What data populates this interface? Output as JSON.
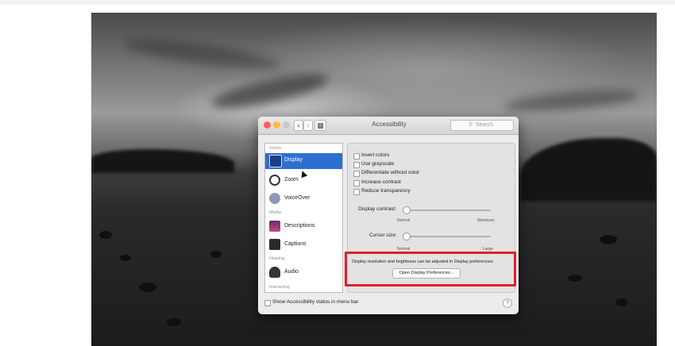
{
  "window": {
    "title": "Accessibility"
  },
  "search": {
    "placeholder": "Search",
    "icon": "search-icon"
  },
  "toolbar": {
    "back": "‹",
    "forward": "›",
    "grid": "▦"
  },
  "sidebar": {
    "sections": [
      {
        "header": "Vision",
        "items": [
          {
            "label": "Display",
            "selected": true,
            "icon": "display-icon"
          },
          {
            "label": "Zoom",
            "icon": "zoom-icon"
          },
          {
            "label": "VoiceOver",
            "icon": "voiceover-icon"
          }
        ]
      },
      {
        "header": "Media",
        "items": [
          {
            "label": "Descriptions",
            "icon": "descriptions-icon"
          },
          {
            "label": "Captions",
            "icon": "captions-icon"
          }
        ]
      },
      {
        "header": "Hearing",
        "items": [
          {
            "label": "Audio",
            "icon": "audio-icon"
          }
        ]
      },
      {
        "header": "Interacting",
        "items": []
      }
    ]
  },
  "options": [
    {
      "label": "Invert colors",
      "checked": false
    },
    {
      "label": "Use grayscale",
      "checked": false
    },
    {
      "label": "Differentiate without color",
      "checked": false
    },
    {
      "label": "Increase contrast",
      "checked": false
    },
    {
      "label": "Reduce transparency",
      "checked": false
    }
  ],
  "contrast": {
    "label": "Display contrast:",
    "min_label": "Normal",
    "max_label": "Maximum",
    "level": 0
  },
  "cursor_size": {
    "label": "Cursor size:",
    "min_label": "Normal",
    "max_label": "Large",
    "level": 0
  },
  "note": "Display resolution and brightness can be adjusted in Display preferences:",
  "open_display_button": "Open Display Preferences...",
  "status_checkbox": {
    "label": "Show Accessibility status in menu bar",
    "checked": false
  },
  "help": "?",
  "colors": {
    "accent": "#2d6fd0",
    "highlight_box": "#d9232e",
    "close": "#fc605c",
    "minimize": "#fdbc40",
    "zoom": "#c9c9c9"
  }
}
